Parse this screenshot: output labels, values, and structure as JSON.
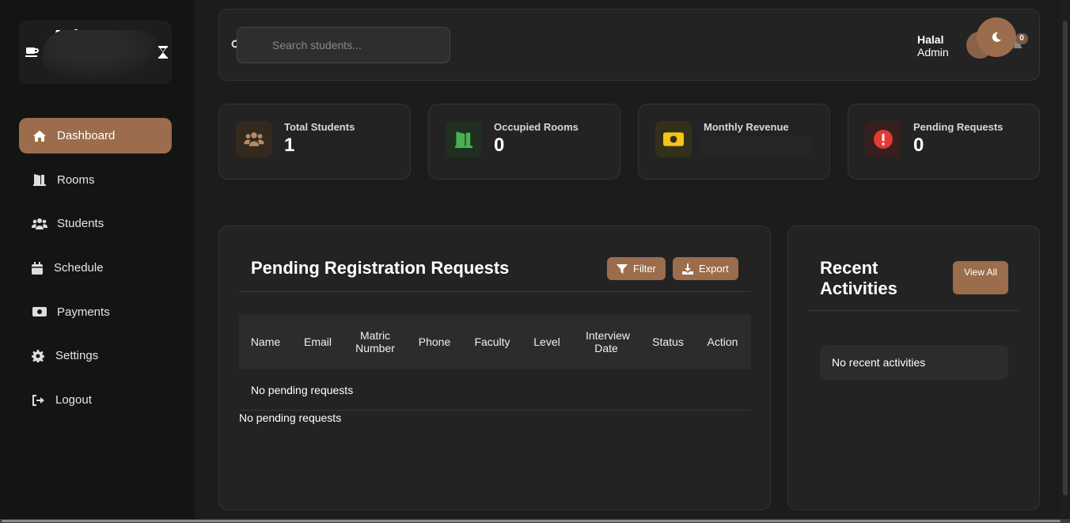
{
  "sidebar": {
    "brand_text": "Adm",
    "items": [
      {
        "label": "Dashboard",
        "icon": "home-icon"
      },
      {
        "label": "Rooms",
        "icon": "door-icon"
      },
      {
        "label": "Students",
        "icon": "users-icon"
      },
      {
        "label": "Schedule",
        "icon": "calendar-icon"
      },
      {
        "label": "Payments",
        "icon": "money-icon"
      },
      {
        "label": "Settings",
        "icon": "gear-icon"
      },
      {
        "label": "Logout",
        "icon": "logout-icon"
      }
    ]
  },
  "header": {
    "search_placeholder": "Search students...",
    "user_name": "Halal",
    "user_role": "Admin",
    "notification_count": "0"
  },
  "stats": [
    {
      "label": "Total Students",
      "value": "1",
      "icon": "users-icon",
      "color": "#b98a63"
    },
    {
      "label": "Occupied Rooms",
      "value": "0",
      "icon": "door-open-icon",
      "color": "#4caf50"
    },
    {
      "label": "Monthly Revenue",
      "value": "",
      "icon": "money-bill-icon",
      "color": "#f5c518"
    },
    {
      "label": "Pending Requests",
      "value": "0",
      "icon": "alert-icon",
      "color": "#e53935"
    }
  ],
  "pending": {
    "title": "Pending Registration Requests",
    "filter_label": "Filter",
    "export_label": "Export",
    "columns": [
      "Name",
      "Email",
      "Matric Number",
      "Phone",
      "Faculty",
      "Level",
      "Interview Date",
      "Status",
      "Action"
    ],
    "empty_row": "No pending requests",
    "empty_text": "No pending requests"
  },
  "activities": {
    "title": "Recent Activities",
    "view_all_label": "View All",
    "empty_text": "No recent activities"
  },
  "colors": {
    "accent": "#9b6d4c",
    "background": "#1c1c1c",
    "card": "#232323"
  }
}
